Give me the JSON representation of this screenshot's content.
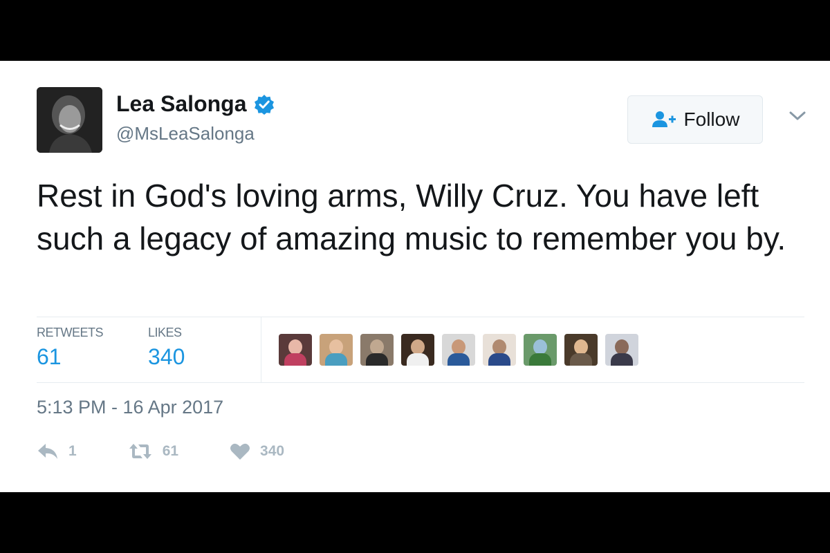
{
  "tweet": {
    "author": {
      "name": "Lea Salonga",
      "handle": "@MsLeaSalonga",
      "verified": true
    },
    "follow_label": "Follow",
    "text": "Rest in God's loving arms, Willy Cruz. You have left such a legacy of amazing music to remember you by.",
    "stats": {
      "retweets_label": "RETWEETS",
      "retweets": "61",
      "likes_label": "LIKES",
      "likes": "340"
    },
    "timestamp": "5:13 PM - 16 Apr 2017",
    "actions": {
      "reply_count": "1",
      "retweet_count": "61",
      "like_count": "340"
    }
  },
  "icons": {
    "verified": "verified-badge-icon",
    "follow": "add-user-icon",
    "menu": "chevron-down-icon",
    "reply": "reply-icon",
    "retweet": "retweet-icon",
    "like": "heart-icon"
  },
  "colors": {
    "accent": "#1b95e0",
    "text": "#14171a",
    "muted": "#657786",
    "action_gray": "#aab8c2"
  }
}
